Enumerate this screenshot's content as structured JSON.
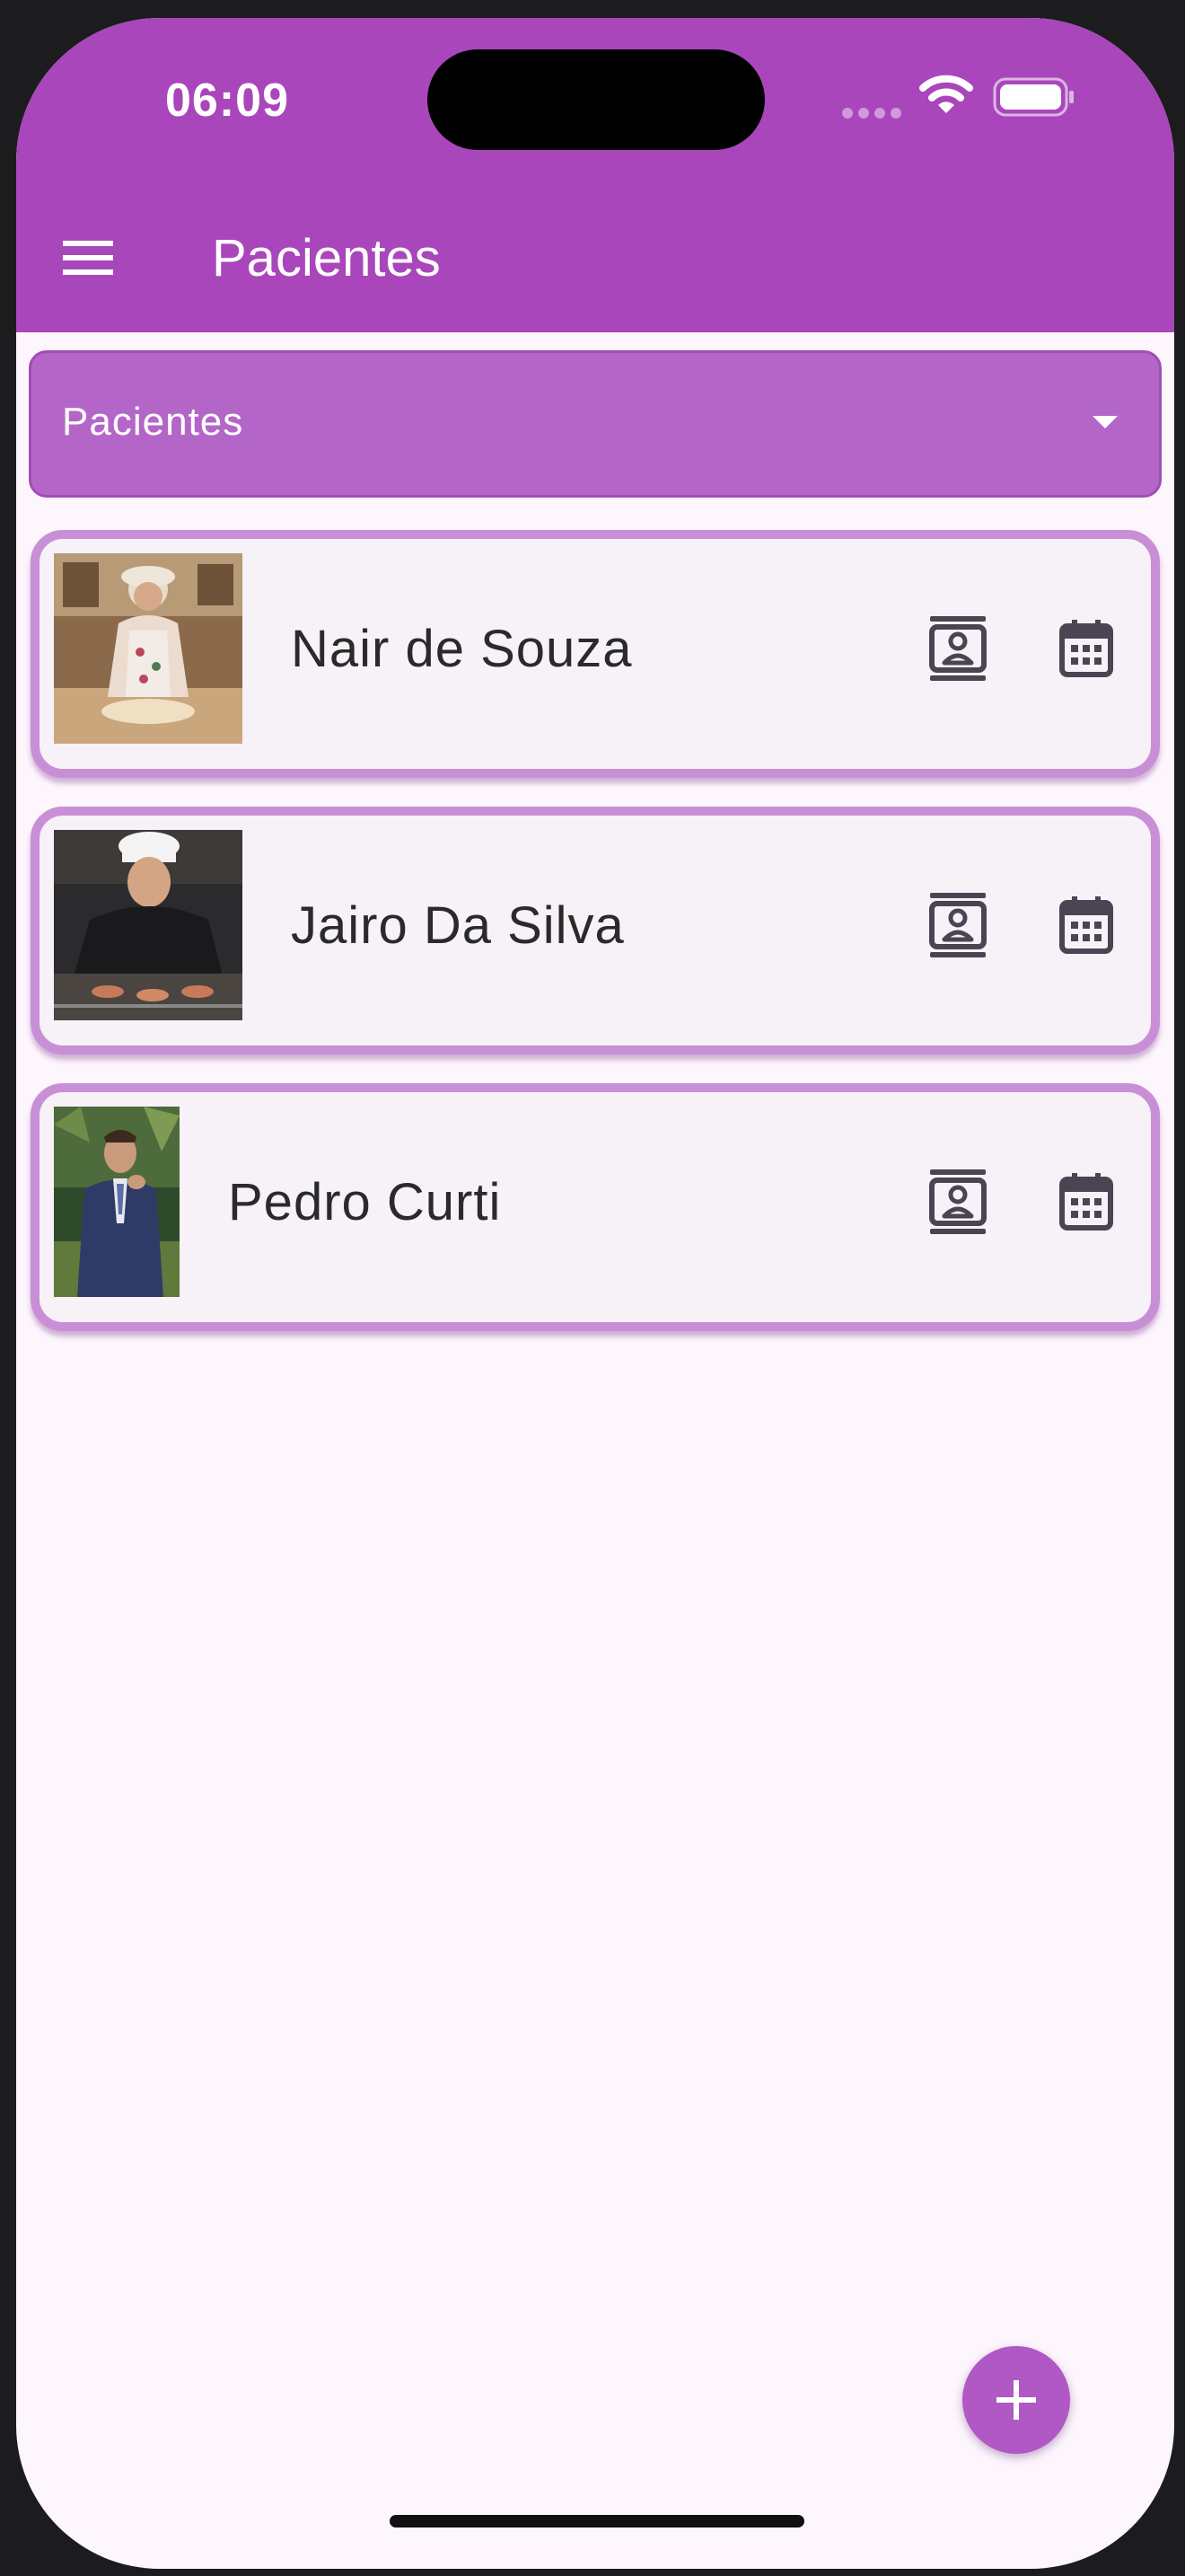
{
  "status_bar": {
    "time": "06:09"
  },
  "app_bar": {
    "title": "Pacientes",
    "menu_icon": "hamburger-menu-icon"
  },
  "filter_dropdown": {
    "selected": "Pacientes",
    "arrow_icon": "dropdown-arrow-icon"
  },
  "patients": [
    {
      "name": "Nair de Souza",
      "photo": "elderly woman baking",
      "actions": [
        "contact-card-icon",
        "calendar-icon"
      ]
    },
    {
      "name": "Jairo Da Silva",
      "photo": "chef grilling",
      "actions": [
        "contact-card-icon",
        "calendar-icon"
      ]
    },
    {
      "name": "Pedro Curti",
      "photo": "man in blue suit",
      "actions": [
        "contact-card-icon",
        "calendar-icon"
      ]
    }
  ],
  "fab": {
    "icon": "plus-icon"
  },
  "colors": {
    "primary": "#a946bb",
    "dropdown": "#b466c8",
    "card_border": "#c98fd6",
    "card_background": "#f6f2f8",
    "background": "#fdf6fd",
    "fab": "#b059c4"
  }
}
